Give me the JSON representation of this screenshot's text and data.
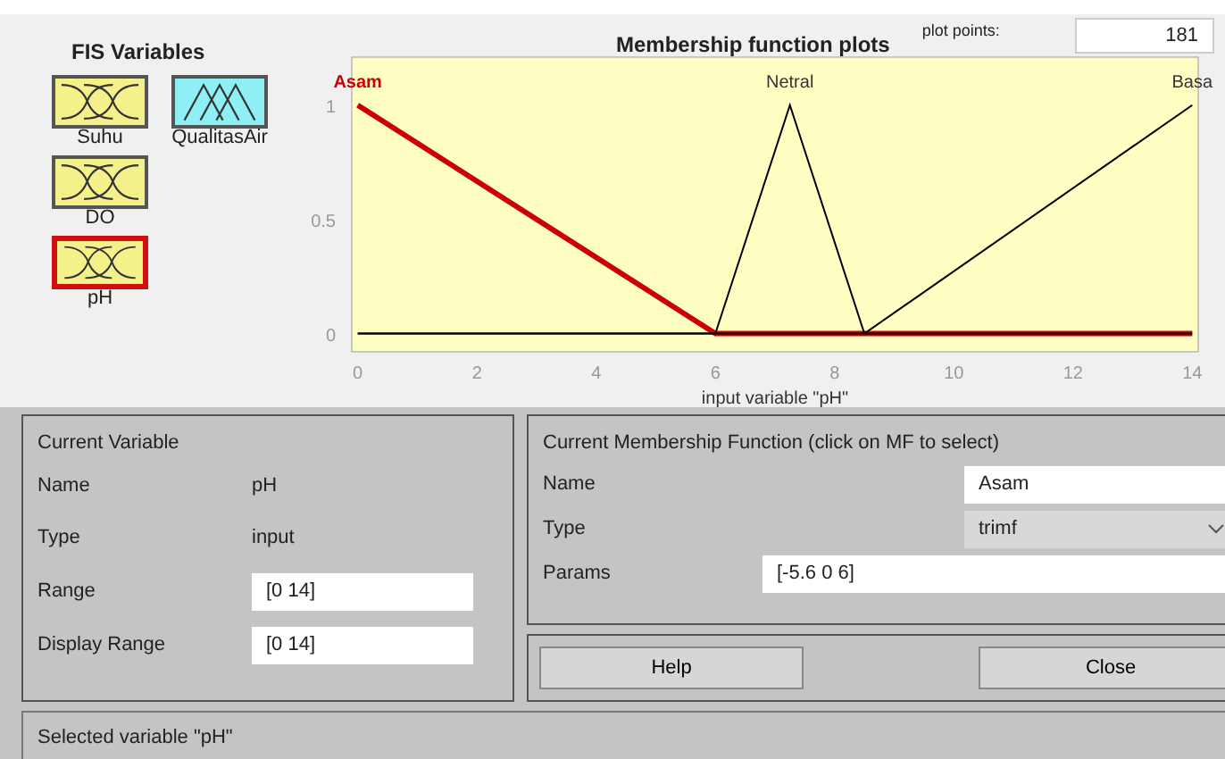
{
  "fis_variables": {
    "title": "FIS Variables",
    "items": [
      {
        "label": "Suhu",
        "kind": "input",
        "selected": false
      },
      {
        "label": "QualitasAir",
        "kind": "output",
        "selected": false
      },
      {
        "label": "DO",
        "kind": "input",
        "selected": false
      },
      {
        "label": "pH",
        "kind": "input",
        "selected": true
      }
    ]
  },
  "plot": {
    "plot_points_label": "plot points:",
    "plot_points": "181",
    "chart_data": {
      "type": "line",
      "title": "Membership function plots",
      "xlabel": "input variable \"pH\"",
      "x": [
        0,
        6,
        7.25,
        8.5,
        14
      ],
      "series": [
        {
          "name": "Asam",
          "color": "#cc0000",
          "values": [
            1,
            0,
            0,
            0,
            0
          ]
        },
        {
          "name": "Netral",
          "color": "#000000",
          "values": [
            0,
            0,
            1,
            0,
            0
          ]
        },
        {
          "name": "Basa",
          "color": "#000000",
          "values": [
            0,
            0,
            0,
            0,
            1
          ]
        }
      ],
      "xlim": [
        -0.1,
        14.1
      ],
      "ylim": [
        -0.08,
        1.21
      ],
      "xticks": [
        0,
        2,
        4,
        6,
        8,
        10,
        12,
        14
      ],
      "yticks": [
        0,
        0.5,
        1
      ]
    }
  },
  "current_variable": {
    "title": "Current Variable",
    "name_label": "Name",
    "name": "pH",
    "type_label": "Type",
    "type": "input",
    "range_label": "Range",
    "range": "[0 14]",
    "display_range_label": "Display Range",
    "display_range": "[0 14]"
  },
  "current_mf": {
    "title": "Current Membership Function (click on MF to select)",
    "name_label": "Name",
    "name": "Asam",
    "type_label": "Type",
    "type": "trimf",
    "params_label": "Params",
    "params": "[-5.6 0 6]"
  },
  "buttons": [
    "Help",
    "Close"
  ],
  "status": "Selected variable \"pH\""
}
